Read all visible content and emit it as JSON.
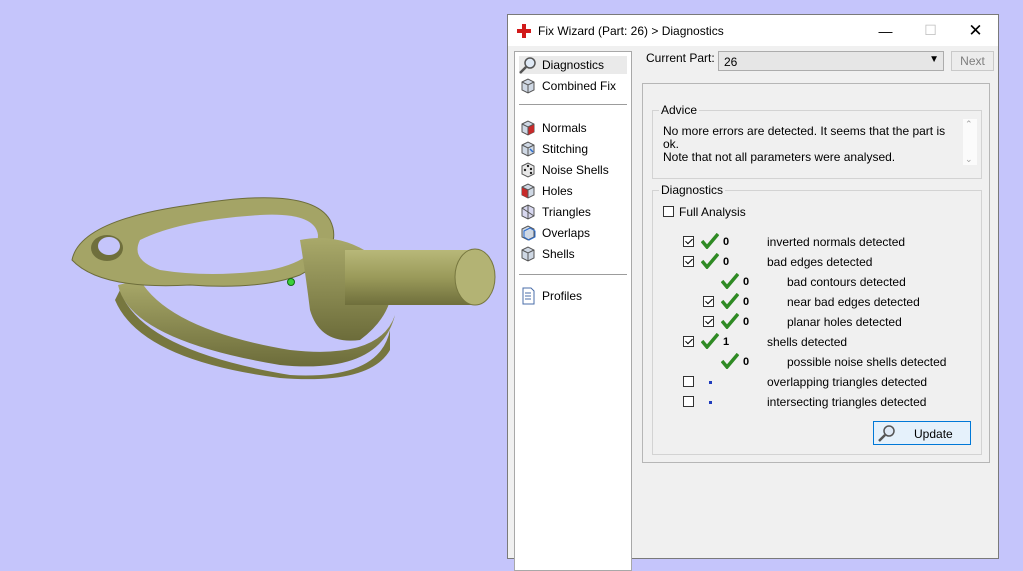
{
  "window": {
    "title": "Fix Wizard (Part: 26) > Diagnostics",
    "minimize_glyph": "—",
    "maximize_glyph": "☐",
    "close_glyph": "✕"
  },
  "nav": {
    "items": [
      {
        "label": "Diagnostics",
        "icon": "magnifier-icon"
      },
      {
        "label": "Combined Fix",
        "icon": "cube-icon"
      },
      {
        "label": "Normals",
        "icon": "cube-red-face-icon"
      },
      {
        "label": "Stitching",
        "icon": "cube-stitch-icon"
      },
      {
        "label": "Noise Shells",
        "icon": "dice-icon"
      },
      {
        "label": "Holes",
        "icon": "cube-hole-icon"
      },
      {
        "label": "Triangles",
        "icon": "triangle-cube-icon"
      },
      {
        "label": "Overlaps",
        "icon": "overlap-cube-icon"
      },
      {
        "label": "Shells",
        "icon": "shells-cube-icon"
      },
      {
        "label": "Profiles",
        "icon": "document-icon"
      }
    ]
  },
  "current_part": {
    "label": "Current Part:",
    "value": "26",
    "next_label": "Next"
  },
  "advice": {
    "title": "Advice",
    "line1": "No more errors are detected. It seems that the part is ok.",
    "line2": "Note that not all parameters were analysed."
  },
  "diagnostics": {
    "title": "Diagnostics",
    "full_analysis_label": "Full Analysis",
    "rows": [
      {
        "count": "0",
        "label": "inverted normals detected"
      },
      {
        "count": "0",
        "label": "bad edges detected"
      },
      {
        "count": "0",
        "label": "bad contours detected"
      },
      {
        "count": "0",
        "label": "near bad edges detected"
      },
      {
        "count": "0",
        "label": "planar holes detected"
      },
      {
        "count": "1",
        "label": "shells detected"
      },
      {
        "count": "0",
        "label": "possible noise shells detected"
      },
      {
        "count": "",
        "label": "overlapping triangles detected"
      },
      {
        "count": "",
        "label": "intersecting triangles detected"
      }
    ],
    "update_label": "Update"
  },
  "colors": {
    "viewport_bg": "#c5c5fb",
    "part_color": "#9b9b5a",
    "check_green": "#2f8a24",
    "selection_blue": "#0078d7"
  }
}
